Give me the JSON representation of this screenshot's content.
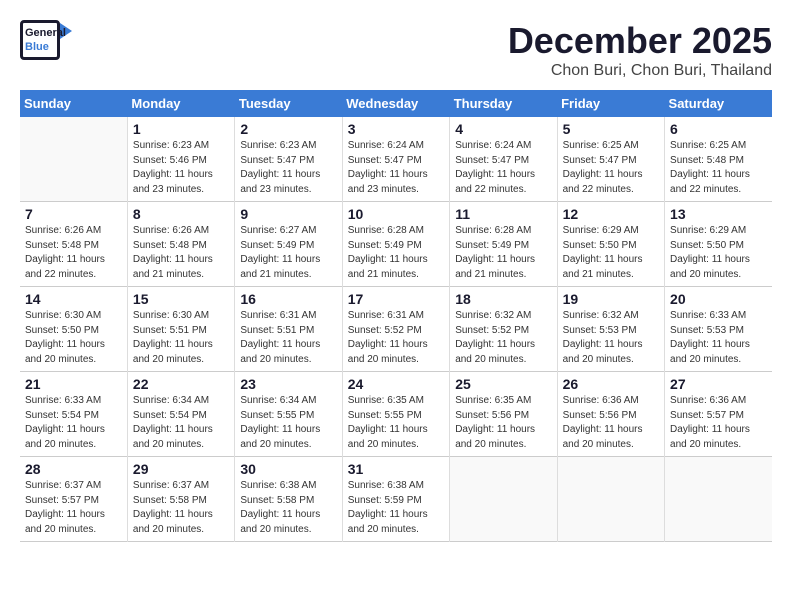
{
  "logo": {
    "line1": "General",
    "line2": "Blue"
  },
  "title": "December 2025",
  "subtitle": "Chon Buri, Chon Buri, Thailand",
  "days_of_week": [
    "Sunday",
    "Monday",
    "Tuesday",
    "Wednesday",
    "Thursday",
    "Friday",
    "Saturday"
  ],
  "weeks": [
    [
      {
        "day": "",
        "info": ""
      },
      {
        "day": "1",
        "info": "Sunrise: 6:23 AM\nSunset: 5:46 PM\nDaylight: 11 hours\nand 23 minutes."
      },
      {
        "day": "2",
        "info": "Sunrise: 6:23 AM\nSunset: 5:47 PM\nDaylight: 11 hours\nand 23 minutes."
      },
      {
        "day": "3",
        "info": "Sunrise: 6:24 AM\nSunset: 5:47 PM\nDaylight: 11 hours\nand 23 minutes."
      },
      {
        "day": "4",
        "info": "Sunrise: 6:24 AM\nSunset: 5:47 PM\nDaylight: 11 hours\nand 22 minutes."
      },
      {
        "day": "5",
        "info": "Sunrise: 6:25 AM\nSunset: 5:47 PM\nDaylight: 11 hours\nand 22 minutes."
      },
      {
        "day": "6",
        "info": "Sunrise: 6:25 AM\nSunset: 5:48 PM\nDaylight: 11 hours\nand 22 minutes."
      }
    ],
    [
      {
        "day": "7",
        "info": "Sunrise: 6:26 AM\nSunset: 5:48 PM\nDaylight: 11 hours\nand 22 minutes."
      },
      {
        "day": "8",
        "info": "Sunrise: 6:26 AM\nSunset: 5:48 PM\nDaylight: 11 hours\nand 21 minutes."
      },
      {
        "day": "9",
        "info": "Sunrise: 6:27 AM\nSunset: 5:49 PM\nDaylight: 11 hours\nand 21 minutes."
      },
      {
        "day": "10",
        "info": "Sunrise: 6:28 AM\nSunset: 5:49 PM\nDaylight: 11 hours\nand 21 minutes."
      },
      {
        "day": "11",
        "info": "Sunrise: 6:28 AM\nSunset: 5:49 PM\nDaylight: 11 hours\nand 21 minutes."
      },
      {
        "day": "12",
        "info": "Sunrise: 6:29 AM\nSunset: 5:50 PM\nDaylight: 11 hours\nand 21 minutes."
      },
      {
        "day": "13",
        "info": "Sunrise: 6:29 AM\nSunset: 5:50 PM\nDaylight: 11 hours\nand 20 minutes."
      }
    ],
    [
      {
        "day": "14",
        "info": "Sunrise: 6:30 AM\nSunset: 5:50 PM\nDaylight: 11 hours\nand 20 minutes."
      },
      {
        "day": "15",
        "info": "Sunrise: 6:30 AM\nSunset: 5:51 PM\nDaylight: 11 hours\nand 20 minutes."
      },
      {
        "day": "16",
        "info": "Sunrise: 6:31 AM\nSunset: 5:51 PM\nDaylight: 11 hours\nand 20 minutes."
      },
      {
        "day": "17",
        "info": "Sunrise: 6:31 AM\nSunset: 5:52 PM\nDaylight: 11 hours\nand 20 minutes."
      },
      {
        "day": "18",
        "info": "Sunrise: 6:32 AM\nSunset: 5:52 PM\nDaylight: 11 hours\nand 20 minutes."
      },
      {
        "day": "19",
        "info": "Sunrise: 6:32 AM\nSunset: 5:53 PM\nDaylight: 11 hours\nand 20 minutes."
      },
      {
        "day": "20",
        "info": "Sunrise: 6:33 AM\nSunset: 5:53 PM\nDaylight: 11 hours\nand 20 minutes."
      }
    ],
    [
      {
        "day": "21",
        "info": "Sunrise: 6:33 AM\nSunset: 5:54 PM\nDaylight: 11 hours\nand 20 minutes."
      },
      {
        "day": "22",
        "info": "Sunrise: 6:34 AM\nSunset: 5:54 PM\nDaylight: 11 hours\nand 20 minutes."
      },
      {
        "day": "23",
        "info": "Sunrise: 6:34 AM\nSunset: 5:55 PM\nDaylight: 11 hours\nand 20 minutes."
      },
      {
        "day": "24",
        "info": "Sunrise: 6:35 AM\nSunset: 5:55 PM\nDaylight: 11 hours\nand 20 minutes."
      },
      {
        "day": "25",
        "info": "Sunrise: 6:35 AM\nSunset: 5:56 PM\nDaylight: 11 hours\nand 20 minutes."
      },
      {
        "day": "26",
        "info": "Sunrise: 6:36 AM\nSunset: 5:56 PM\nDaylight: 11 hours\nand 20 minutes."
      },
      {
        "day": "27",
        "info": "Sunrise: 6:36 AM\nSunset: 5:57 PM\nDaylight: 11 hours\nand 20 minutes."
      }
    ],
    [
      {
        "day": "28",
        "info": "Sunrise: 6:37 AM\nSunset: 5:57 PM\nDaylight: 11 hours\nand 20 minutes."
      },
      {
        "day": "29",
        "info": "Sunrise: 6:37 AM\nSunset: 5:58 PM\nDaylight: 11 hours\nand 20 minutes."
      },
      {
        "day": "30",
        "info": "Sunrise: 6:38 AM\nSunset: 5:58 PM\nDaylight: 11 hours\nand 20 minutes."
      },
      {
        "day": "31",
        "info": "Sunrise: 6:38 AM\nSunset: 5:59 PM\nDaylight: 11 hours\nand 20 minutes."
      },
      {
        "day": "",
        "info": ""
      },
      {
        "day": "",
        "info": ""
      },
      {
        "day": "",
        "info": ""
      }
    ]
  ]
}
